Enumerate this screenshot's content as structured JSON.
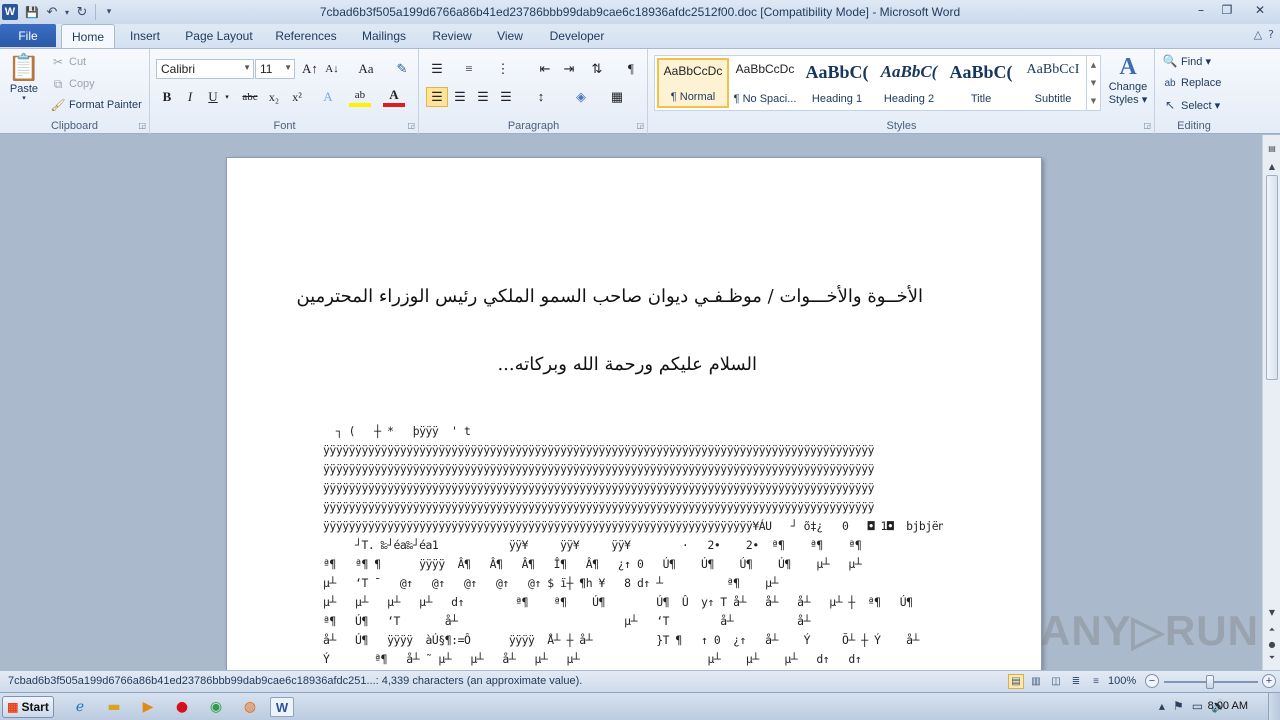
{
  "window": {
    "title": "7cbad6b3f505a199d6766a86b41ed23786bbb99dab9cae6c18936afdc2512f00.doc [Compatibility Mode]  -  Microsoft Word",
    "app_icon_letter": "W",
    "min_glyph": "–",
    "max_glyph": "❐",
    "close_glyph": "✕"
  },
  "qat": {
    "save_glyph": "💾",
    "undo_glyph": "↶",
    "redo_glyph": "↻",
    "more_glyph": "▾"
  },
  "tabs": {
    "file": "File",
    "items": [
      "Home",
      "Insert",
      "Page Layout",
      "References",
      "Mailings",
      "Review",
      "View",
      "Developer"
    ],
    "help_glyph": "?"
  },
  "clipboard": {
    "paste": "Paste",
    "cut": "Cut",
    "copy": "Copy",
    "format_painter": "Format Painter",
    "label": "Clipboard"
  },
  "font": {
    "name": "Calibri",
    "size": "11",
    "label": "Font",
    "bold": "B",
    "italic": "I",
    "underline": "U",
    "strike": "abc",
    "sub": "x₂",
    "sup": "x²",
    "grow": "A↑",
    "shrink": "A↓",
    "case": "Aa",
    "effects": "A",
    "highlight": "ab",
    "color": "A"
  },
  "paragraph": {
    "label": "Paragraph",
    "pilcrow": "¶"
  },
  "styles": {
    "label": "Styles",
    "items": [
      {
        "sample": "AaBbCcDc",
        "name": "¶ Normal"
      },
      {
        "sample": "AaBbCcDc",
        "name": "¶ No Spaci..."
      },
      {
        "sample": "AaBbC(",
        "name": "Heading 1"
      },
      {
        "sample": "AaBbC(",
        "name": "Heading 2"
      },
      {
        "sample": "AaBbC(",
        "name": "Title"
      },
      {
        "sample": "AaBbCcI",
        "name": "Subtitle"
      }
    ],
    "change_styles_line1": "Change",
    "change_styles_line2": "Styles ▾"
  },
  "editing": {
    "label": "Editing",
    "find": "Find ▾",
    "replace": "Replace",
    "select": "Select ▾"
  },
  "document": {
    "arabic_line1": "الأخــوة والأخـــوات / موظـفـي ديوان صاحب السمو الملكي رئيس الوزراء المحترمين",
    "arabic_line2": "السلام عليكم ورحمة الله وبركاته...",
    "garbage_lines": [
      "  ┐ (   ┼ *   þÿÿÿ  ' t",
      "ÿÿÿÿÿÿÿÿÿÿÿÿÿÿÿÿÿÿÿÿÿÿÿÿÿÿÿÿÿÿÿÿÿÿÿÿÿÿÿÿÿÿÿÿÿÿÿÿÿÿÿÿÿÿÿÿÿÿÿÿÿÿÿÿÿÿÿÿÿÿÿÿÿÿÿÿÿÿÿÿÿÿÿÿÿÿ",
      "ÿÿÿÿÿÿÿÿÿÿÿÿÿÿÿÿÿÿÿÿÿÿÿÿÿÿÿÿÿÿÿÿÿÿÿÿÿÿÿÿÿÿÿÿÿÿÿÿÿÿÿÿÿÿÿÿÿÿÿÿÿÿÿÿÿÿÿÿÿÿÿÿÿÿÿÿÿÿÿÿÿÿÿÿÿÿ",
      "ÿÿÿÿÿÿÿÿÿÿÿÿÿÿÿÿÿÿÿÿÿÿÿÿÿÿÿÿÿÿÿÿÿÿÿÿÿÿÿÿÿÿÿÿÿÿÿÿÿÿÿÿÿÿÿÿÿÿÿÿÿÿÿÿÿÿÿÿÿÿÿÿÿÿÿÿÿÿÿÿÿÿÿÿÿÿ",
      "ÿÿÿÿÿÿÿÿÿÿÿÿÿÿÿÿÿÿÿÿÿÿÿÿÿÿÿÿÿÿÿÿÿÿÿÿÿÿÿÿÿÿÿÿÿÿÿÿÿÿÿÿÿÿÿÿÿÿÿÿÿÿÿÿÿÿÿÿÿÿÿÿÿÿÿÿÿÿÿÿÿÿÿÿÿÿ",
      "ÿÿÿÿÿÿÿÿÿÿÿÿÿÿÿÿÿÿÿÿÿÿÿÿÿÿÿÿÿÿÿÿÿÿÿÿÿÿÿÿÿÿÿÿÿÿÿÿÿÿÿÿÿÿÿÿÿÿÿÿÿÿÿÿÿÿÿ¥ÁU   ┘ õ‡¿   0   ◘ 1◘  bjbjënën",
      "     ┘T. ‰┘éa‰┘éa1           ÿÿ¥     ÿÿ¥     ÿÿ¥        ·   2•    2•  ª¶    ª¶    ª¶",
      "ª¶   ª¶ ¶      ÿÿÿÿ  Â¶   Â¶   Â¶   Î¶   Â¶   ¿↑ 0   Ú¶    Ú¶    Ú¶    Ú¶    µ┴   µ┴",
      "µ┴   ʻT ¯   @↑   @↑   @↑   @↑   @↑ $ ï┼ ¶h ¥   8 d↑ ┴          ª¶    µ┴",
      "µ┴   µ┴   µ┴   µ┴   d↑        ª¶    ª¶    Ú¶        Ú¶  Û  y↑ T å┴   å┴   å┴   µ┴ ┼  ª¶   Ú¶",
      "ª¶   Ú¶   ʻT       å┴                          µ┴   ʻT        å┴          å┴",
      "å┴   Ú¶   ÿÿÿÿ  àÚ§¶:=Ô      ÿÿÿÿ  Å┴ ┼ å┴          }T ¶   ↑ 0  ¿↑   å┴    Ý     Õ┴ ┼ Ý    å┴",
      "Ý       ª¶   å┴ ˜ µ┴   µ┴   å┴   µ┴   µ┴                    µ┴    µ┴    µ┴   d↑   d↑"
    ]
  },
  "status": {
    "text": "7cbad6b3f505a199d6766a86b41ed23786bbb99dab9cae6c18936afdc251...: 4,339 characters (an approximate value).",
    "zoom": "100%",
    "zoom_level_percent": 100
  },
  "taskbar": {
    "start": "Start",
    "clock": "8:00 AM",
    "apps": [
      "internet-explorer",
      "file-explorer",
      "media-player",
      "opera",
      "chrome",
      "firefox",
      "word"
    ]
  },
  "watermark": "ANY▷RUN"
}
